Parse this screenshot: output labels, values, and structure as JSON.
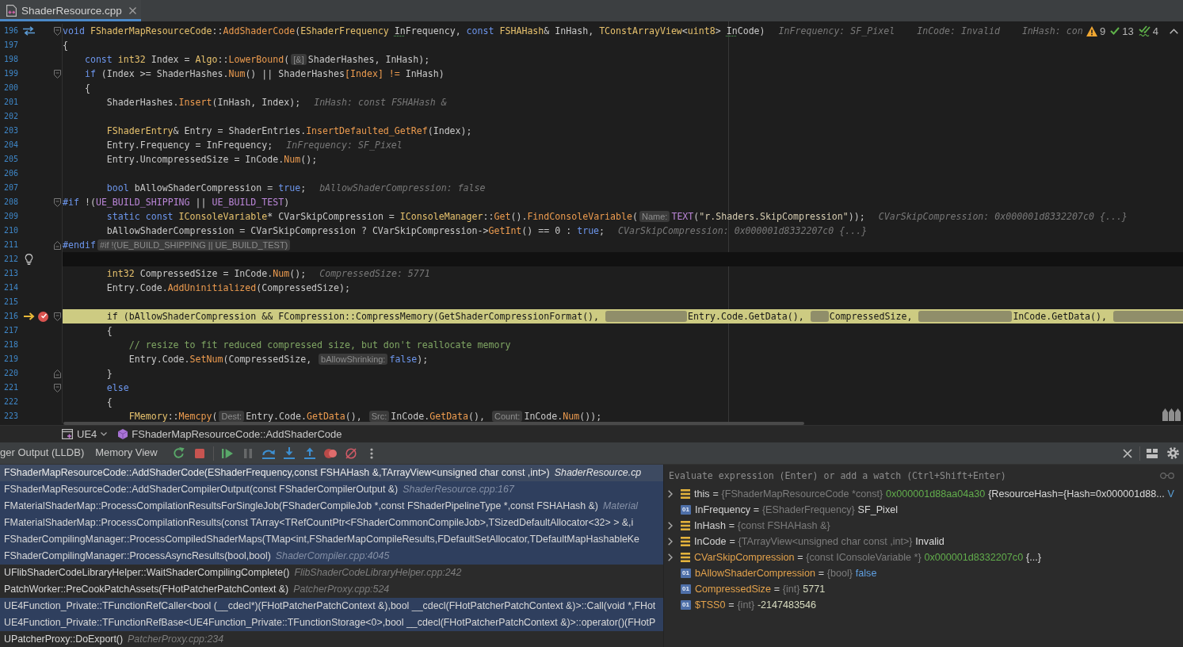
{
  "editor_tabs": [
    {
      "label": "ShaderResource.cpp",
      "selected": true
    }
  ],
  "editor": {
    "inspections": [
      {
        "kind": "warning",
        "count": "9"
      },
      {
        "kind": "check",
        "count": "13"
      },
      {
        "kind": "double_check",
        "count": "4"
      }
    ],
    "lines": [
      {
        "number": "196",
        "fold_start": true,
        "fold_end": false,
        "declaration_link": true,
        "current": false,
        "execution_point": false,
        "breakpoint": false,
        "tokens": [
          {
            "kind": "keyword",
            "text": "void"
          },
          {
            "kind": "type",
            "text": " FShaderMapResourceCode"
          },
          {
            "kind": "plain",
            "text": "::"
          },
          {
            "kind": "function",
            "text": "AddShaderCode"
          },
          {
            "kind": "plain",
            "text": "("
          },
          {
            "kind": "type",
            "text": "EShaderFrequency "
          },
          {
            "kind": "flagged",
            "text": "In"
          },
          {
            "kind": "plain",
            "text": "Frequency, "
          },
          {
            "kind": "keyword",
            "text": "const"
          },
          {
            "kind": "type",
            "text": " FSHAHash"
          },
          {
            "kind": "plain",
            "text": "& InHash, "
          },
          {
            "kind": "type",
            "text": "TConstArrayView"
          },
          {
            "kind": "plain",
            "text": "<"
          },
          {
            "kind": "type",
            "text": "uint8"
          },
          {
            "kind": "plain",
            "text": "> "
          },
          {
            "kind": "flagged",
            "text": "In"
          },
          {
            "kind": "plain",
            "text": "Code)"
          }
        ],
        "inline_values": [
          "InFrequency: SF_Pixel",
          "InCode: Invalid",
          "InHash: con"
        ]
      },
      {
        "number": "197",
        "fold_start": false,
        "fold_end": false,
        "declaration_link": false,
        "current": false,
        "execution_point": false,
        "breakpoint": false,
        "tokens": [
          {
            "kind": "plain",
            "text": "{"
          }
        ]
      },
      {
        "number": "198",
        "fold_start": false,
        "fold_end": false,
        "declaration_link": false,
        "current": false,
        "execution_point": false,
        "breakpoint": false,
        "tokens": [
          {
            "kind": "keyword",
            "text": "    const"
          },
          {
            "kind": "type",
            "text": " int32"
          },
          {
            "kind": "plain",
            "text": " Index = "
          },
          {
            "kind": "type",
            "text": "Algo"
          },
          {
            "kind": "plain",
            "text": "::"
          },
          {
            "kind": "function",
            "text": "LowerBound"
          },
          {
            "kind": "plain",
            "text": "("
          },
          {
            "kind": "hint",
            "text": "[&]"
          },
          {
            "kind": "plain",
            "text": "ShaderHashes, InHash);"
          }
        ]
      },
      {
        "number": "199",
        "fold_start": true,
        "fold_end": false,
        "declaration_link": false,
        "current": false,
        "execution_point": false,
        "breakpoint": false,
        "tokens": [
          {
            "kind": "keyword",
            "text": "    if"
          },
          {
            "kind": "plain",
            "text": " (Index >= ShaderHashes."
          },
          {
            "kind": "function",
            "text": "Num"
          },
          {
            "kind": "plain",
            "text": "() || ShaderHashes"
          },
          {
            "kind": "function",
            "text": "[Index]"
          },
          {
            "kind": "function",
            "text": " !="
          },
          {
            "kind": "plain",
            "text": " InHash)"
          }
        ]
      },
      {
        "number": "200",
        "fold_start": false,
        "fold_end": false,
        "declaration_link": false,
        "current": false,
        "execution_point": false,
        "breakpoint": false,
        "tokens": [
          {
            "kind": "plain",
            "text": "    {"
          }
        ]
      },
      {
        "number": "201",
        "fold_start": false,
        "fold_end": false,
        "declaration_link": false,
        "current": false,
        "execution_point": false,
        "breakpoint": false,
        "tokens": [
          {
            "kind": "plain",
            "text": "        ShaderHashes."
          },
          {
            "kind": "function",
            "text": "Insert"
          },
          {
            "kind": "plain",
            "text": "(InHash, Index);"
          }
        ],
        "inline_values": [
          "InHash: const FSHAHash &"
        ]
      },
      {
        "number": "202",
        "fold_start": false,
        "fold_end": false,
        "declaration_link": false,
        "current": false,
        "execution_point": false,
        "breakpoint": false
      },
      {
        "number": "203",
        "fold_start": false,
        "fold_end": false,
        "declaration_link": false,
        "current": false,
        "execution_point": false,
        "breakpoint": false,
        "tokens": [
          {
            "kind": "type",
            "text": "        FShaderEntry"
          },
          {
            "kind": "plain",
            "text": "& Entry = ShaderEntries."
          },
          {
            "kind": "function",
            "text": "InsertDefaulted_GetRef"
          },
          {
            "kind": "plain",
            "text": "(Index);"
          }
        ]
      },
      {
        "number": "204",
        "fold_start": false,
        "fold_end": false,
        "declaration_link": false,
        "current": false,
        "execution_point": false,
        "breakpoint": false,
        "tokens": [
          {
            "kind": "plain",
            "text": "        Entry.Frequency = InFrequency;"
          }
        ],
        "inline_values": [
          "InFrequency: SF_Pixel"
        ]
      },
      {
        "number": "205",
        "fold_start": false,
        "fold_end": false,
        "declaration_link": false,
        "current": false,
        "execution_point": false,
        "breakpoint": false,
        "tokens": [
          {
            "kind": "plain",
            "text": "        Entry.UncompressedSize = InCode."
          },
          {
            "kind": "function",
            "text": "Num"
          },
          {
            "kind": "plain",
            "text": "();"
          }
        ]
      },
      {
        "number": "206",
        "fold_start": false,
        "fold_end": false,
        "declaration_link": false,
        "current": false,
        "execution_point": false,
        "breakpoint": false
      },
      {
        "number": "207",
        "fold_start": false,
        "fold_end": false,
        "declaration_link": false,
        "current": false,
        "execution_point": false,
        "breakpoint": false,
        "tokens": [
          {
            "kind": "keyword",
            "text": "        bool"
          },
          {
            "kind": "plain",
            "text": " bAllowShaderCompression = "
          },
          {
            "kind": "keyword",
            "text": "true"
          },
          {
            "kind": "plain",
            "text": ";"
          }
        ],
        "inline_values": [
          "bAllowShaderCompression: false"
        ]
      },
      {
        "number": "208",
        "fold_start": true,
        "fold_end": false,
        "declaration_link": false,
        "current": false,
        "execution_point": false,
        "breakpoint": false,
        "tokens": [
          {
            "kind": "keyword",
            "text": "#if"
          },
          {
            "kind": "plain",
            "text": " !("
          },
          {
            "kind": "macro",
            "text": "UE_BUILD_SHIPPING"
          },
          {
            "kind": "plain",
            "text": " || "
          },
          {
            "kind": "macro",
            "text": "UE_BUILD_TEST"
          },
          {
            "kind": "plain",
            "text": ")"
          }
        ]
      },
      {
        "number": "209",
        "fold_start": false,
        "fold_end": false,
        "declaration_link": false,
        "current": false,
        "execution_point": false,
        "breakpoint": false,
        "tokens": [
          {
            "kind": "keyword",
            "text": "        static const"
          },
          {
            "kind": "type",
            "text": " IConsoleVariable"
          },
          {
            "kind": "plain",
            "text": "* CVarSkipCompression = "
          },
          {
            "kind": "type",
            "text": "IConsoleManager"
          },
          {
            "kind": "plain",
            "text": "::"
          },
          {
            "kind": "function",
            "text": "Get"
          },
          {
            "kind": "plain",
            "text": "()."
          },
          {
            "kind": "function",
            "text": "FindConsoleVariable"
          },
          {
            "kind": "plain",
            "text": "("
          },
          {
            "kind": "hint",
            "text": "Name:"
          },
          {
            "kind": "macro",
            "text": "TEXT"
          },
          {
            "kind": "plain",
            "text": "("
          },
          {
            "kind": "string",
            "text": "\"r.Shaders.SkipCompression\""
          },
          {
            "kind": "plain",
            "text": "));"
          }
        ],
        "inline_values": [
          "CVarSkipCompression: 0x000001d8332207c0 {...}"
        ]
      },
      {
        "number": "210",
        "fold_start": false,
        "fold_end": false,
        "declaration_link": false,
        "current": false,
        "execution_point": false,
        "breakpoint": false,
        "tokens": [
          {
            "kind": "plain",
            "text": "        bAllowShaderCompression = CVarSkipCompression ? CVarSkipCompression->"
          },
          {
            "kind": "function",
            "text": "GetInt"
          },
          {
            "kind": "plain",
            "text": "() == 0 : "
          },
          {
            "kind": "keyword",
            "text": "true"
          },
          {
            "kind": "plain",
            "text": ";"
          }
        ],
        "inline_values": [
          "CVarSkipCompression: 0x000001d8332207c0 {...}"
        ]
      },
      {
        "number": "211",
        "fold_start": false,
        "fold_end": true,
        "declaration_link": false,
        "current": false,
        "execution_point": false,
        "breakpoint": false,
        "tokens": [
          {
            "kind": "keyword",
            "text": "#endif"
          },
          {
            "kind": "hint",
            "text": "#if !(UE_BUILD_SHIPPING || UE_BUILD_TEST)"
          }
        ]
      },
      {
        "number": "212",
        "fold_start": false,
        "fold_end": false,
        "declaration_link": false,
        "current": true,
        "execution_point": false,
        "breakpoint": false
      },
      {
        "number": "213",
        "fold_start": false,
        "fold_end": false,
        "declaration_link": false,
        "current": false,
        "execution_point": false,
        "breakpoint": false,
        "tokens": [
          {
            "kind": "type",
            "text": "        int32"
          },
          {
            "kind": "plain",
            "text": " CompressedSize = InCode."
          },
          {
            "kind": "function",
            "text": "Num"
          },
          {
            "kind": "plain",
            "text": "();"
          }
        ],
        "inline_values": [
          "CompressedSize: 5771"
        ]
      },
      {
        "number": "214",
        "fold_start": false,
        "fold_end": false,
        "declaration_link": false,
        "current": false,
        "execution_point": false,
        "breakpoint": false,
        "tokens": [
          {
            "kind": "plain",
            "text": "        Entry.Code."
          },
          {
            "kind": "function",
            "text": "AddUninitialized"
          },
          {
            "kind": "plain",
            "text": "(CompressedSize);"
          }
        ]
      },
      {
        "number": "215",
        "fold_start": false,
        "fold_end": false,
        "declaration_link": false,
        "current": false,
        "execution_point": false,
        "breakpoint": false
      },
      {
        "number": "216",
        "fold_start": true,
        "fold_end": false,
        "declaration_link": false,
        "current": false,
        "execution_point": true,
        "breakpoint": true,
        "tokens": [
          {
            "kind": "plain",
            "text": "        if (bAllowShaderCompression && FCompression::CompressMemory(GetShaderCompressionFormat(),"
          },
          {
            "kind": "blank"
          },
          {
            "kind": "plain",
            "text": "Entry.Code.GetData(),"
          },
          {
            "kind": "blank"
          },
          {
            "kind": "plain",
            "text": "CompressedSize,"
          },
          {
            "kind": "blank"
          },
          {
            "kind": "plain",
            "text": "InCode.GetData(),"
          },
          {
            "kind": "blank"
          }
        ]
      },
      {
        "number": "217",
        "fold_start": false,
        "fold_end": false,
        "declaration_link": false,
        "current": false,
        "execution_point": false,
        "breakpoint": false,
        "tokens": [
          {
            "kind": "plain",
            "text": "        {"
          }
        ]
      },
      {
        "number": "218",
        "fold_start": false,
        "fold_end": false,
        "declaration_link": false,
        "current": false,
        "execution_point": false,
        "breakpoint": false,
        "tokens": [
          {
            "kind": "comment",
            "text": "            // resize to fit reduced compressed size, but don't reallocate memory"
          }
        ]
      },
      {
        "number": "219",
        "fold_start": false,
        "fold_end": false,
        "declaration_link": false,
        "current": false,
        "execution_point": false,
        "breakpoint": false,
        "tokens": [
          {
            "kind": "plain",
            "text": "            Entry.Code."
          },
          {
            "kind": "function",
            "text": "SetNum"
          },
          {
            "kind": "plain",
            "text": "(CompressedSize, "
          },
          {
            "kind": "hint",
            "text": "bAllowShrinking:"
          },
          {
            "kind": "keyword",
            "text": "false"
          },
          {
            "kind": "plain",
            "text": ");"
          }
        ]
      },
      {
        "number": "220",
        "fold_start": false,
        "fold_end": true,
        "declaration_link": false,
        "current": false,
        "execution_point": false,
        "breakpoint": false,
        "tokens": [
          {
            "kind": "plain",
            "text": "        }"
          }
        ]
      },
      {
        "number": "221",
        "fold_start": true,
        "fold_end": false,
        "declaration_link": false,
        "current": false,
        "execution_point": false,
        "breakpoint": false,
        "tokens": [
          {
            "kind": "keyword",
            "text": "        else"
          }
        ]
      },
      {
        "number": "222",
        "fold_start": false,
        "fold_end": false,
        "declaration_link": false,
        "current": false,
        "execution_point": false,
        "breakpoint": false,
        "tokens": [
          {
            "kind": "plain",
            "text": "        {"
          }
        ]
      },
      {
        "number": "223",
        "fold_start": false,
        "fold_end": false,
        "declaration_link": false,
        "current": false,
        "execution_point": false,
        "breakpoint": false,
        "tokens": [
          {
            "kind": "type",
            "text": "            FMemory"
          },
          {
            "kind": "plain",
            "text": "::"
          },
          {
            "kind": "function",
            "text": "Memcpy"
          },
          {
            "kind": "plain",
            "text": "("
          },
          {
            "kind": "hint",
            "text": "Dest:"
          },
          {
            "kind": "plain",
            "text": "Entry.Code."
          },
          {
            "kind": "function",
            "text": "GetData"
          },
          {
            "kind": "plain",
            "text": "(), "
          },
          {
            "kind": "hint",
            "text": "Src:"
          },
          {
            "kind": "plain",
            "text": "InCode."
          },
          {
            "kind": "function",
            "text": "GetData"
          },
          {
            "kind": "plain",
            "text": "(), "
          },
          {
            "kind": "hint",
            "text": "Count:"
          },
          {
            "kind": "plain",
            "text": "InCode."
          },
          {
            "kind": "function",
            "text": "Num"
          },
          {
            "kind": "plain",
            "text": "());"
          }
        ]
      }
    ]
  },
  "breadcrumbs": [
    {
      "kind": "project",
      "label": "UE4",
      "dropdown": true
    },
    {
      "kind": "function",
      "label": "FShaderMapResourceCode::AddShaderCode",
      "dropdown": false
    }
  ],
  "debug": {
    "tabs": [
      {
        "label": "ger Output (LLDB)",
        "selected": false
      },
      {
        "label": "Memory View",
        "selected": false
      }
    ],
    "toolbar": [
      [
        {
          "kind": "rerun",
          "disabled": false
        },
        {
          "kind": "stop",
          "disabled": false
        }
      ],
      [
        {
          "kind": "resume",
          "disabled": false
        },
        {
          "kind": "pause",
          "disabled": true
        },
        {
          "kind": "step_over",
          "disabled": false
        },
        {
          "kind": "step_into",
          "disabled": false
        },
        {
          "kind": "step_out",
          "disabled": false
        },
        {
          "kind": "view_breakpoints",
          "disabled": false
        },
        {
          "kind": "mute_breakpoints",
          "disabled": false
        },
        {
          "kind": "more",
          "disabled": false
        }
      ]
    ],
    "frames": [
      {
        "function": "FShaderMapResourceCode::AddShaderCode(EShaderFrequency,const FSHAHash &,TArrayView<unsigned char const ,int>)",
        "location": "ShaderResource.cp",
        "selected": true,
        "highlighted": true
      },
      {
        "function": "FShaderMapResourceCode::AddShaderCompilerOutput(const FShaderCompilerOutput &)",
        "location": "ShaderResource.cpp:167",
        "selected": false,
        "highlighted": true
      },
      {
        "function": "FMaterialShaderMap::ProcessCompilationResultsForSingleJob(FShaderCompileJob *,const FShaderPipelineType *,const FSHAHash &)",
        "location": "Material",
        "selected": false,
        "highlighted": true
      },
      {
        "function": "FMaterialShaderMap::ProcessCompilationResults(const TArray<TRefCountPtr<FShaderCommonCompileJob>,TSizedDefaultAllocator<32> > &,i",
        "selected": false,
        "highlighted": true
      },
      {
        "function": "FShaderCompilingManager::ProcessCompiledShaderMaps(TMap<int,FShaderMapCompileResults,FDefaultSetAllocator,TDefaultMapHashableKe",
        "selected": false,
        "highlighted": true
      },
      {
        "function": "FShaderCompilingManager::ProcessAsyncResults(bool,bool)",
        "location": "ShaderCompiler.cpp:4045",
        "selected": false,
        "highlighted": true
      },
      {
        "function": "UFlibShaderCodeLibraryHelper::WaitShaderCompilingComplete()",
        "location": "FlibShaderCodeLibraryHelper.cpp:242",
        "selected": false,
        "highlighted": false
      },
      {
        "function": "PatchWorker::PreCookPatchAssets(FHotPatcherPatchContext &)",
        "location": "PatcherProxy.cpp:524",
        "selected": false,
        "highlighted": false
      },
      {
        "function": "UE4Function_Private::TFunctionRefCaller<bool (__cdecl*)(FHotPatcherPatchContext &),bool __cdecl(FHotPatcherPatchContext &)>::Call(void *,FHot",
        "selected": false,
        "highlighted": true
      },
      {
        "function": "UE4Function_Private::TFunctionRefBase<UE4Function_Private::TFunctionStorage<0>,bool __cdecl(FHotPatcherPatchContext &)>::operator()(FHotP",
        "selected": false,
        "highlighted": true
      },
      {
        "function": "UPatcherProxy::DoExport()",
        "location": "PatcherProxy.cpp:234",
        "selected": false,
        "highlighted": false
      }
    ],
    "evaluate": {
      "placeholder": "Evaluate expression (Enter) or add a watch (Ctrl+Shift+Enter)"
    },
    "variables": [
      {
        "name": "this",
        "operator": "=",
        "type": "{FShaderMapResourceCode *const}",
        "value": [
          {
            "kind": "address",
            "text": "0x000001d88aa04a30"
          },
          {
            "kind": "text",
            "text": "{ResourceHash={Hash=0x000001d88..."
          },
          {
            "kind": "link",
            "text": "V"
          }
        ],
        "expandable": true,
        "name_highlighted": false
      },
      {
        "name": "InFrequency",
        "operator": "=",
        "type": "{EShaderFrequency}",
        "value": [
          {
            "kind": "text",
            "text": "SF_Pixel"
          }
        ],
        "expandable": false,
        "name_highlighted": false,
        "badge": "01"
      },
      {
        "name": "InHash",
        "operator": "=",
        "type": "{const FSHAHash &}",
        "expandable": true,
        "name_highlighted": false
      },
      {
        "name": "InCode",
        "operator": "=",
        "type": "{TArrayView<unsigned char const ,int>}",
        "value": [
          {
            "kind": "text",
            "text": "Invalid"
          }
        ],
        "expandable": true,
        "name_highlighted": false
      },
      {
        "name": "CVarSkipCompression",
        "operator": "=",
        "type": "{const IConsoleVariable *}",
        "value": [
          {
            "kind": "address",
            "text": "0x000001d8332207c0"
          },
          {
            "kind": "text",
            "text": "{...}"
          }
        ],
        "expandable": true,
        "name_highlighted": true
      },
      {
        "name": "bAllowShaderCompression",
        "operator": "=",
        "type": "{bool}",
        "value": [
          {
            "kind": "keyword",
            "text": "false"
          }
        ],
        "expandable": false,
        "name_highlighted": true,
        "badge": "01"
      },
      {
        "name": "CompressedSize",
        "operator": "=",
        "type": "{int}",
        "value": [
          {
            "kind": "number",
            "text": "5771"
          }
        ],
        "expandable": false,
        "name_highlighted": true,
        "badge": "01"
      },
      {
        "name": "$TSS0",
        "operator": "=",
        "type": "{int}",
        "value": [
          {
            "kind": "number",
            "text": "-2147483546"
          }
        ],
        "expandable": false,
        "name_highlighted": true,
        "badge": "01"
      }
    ]
  }
}
